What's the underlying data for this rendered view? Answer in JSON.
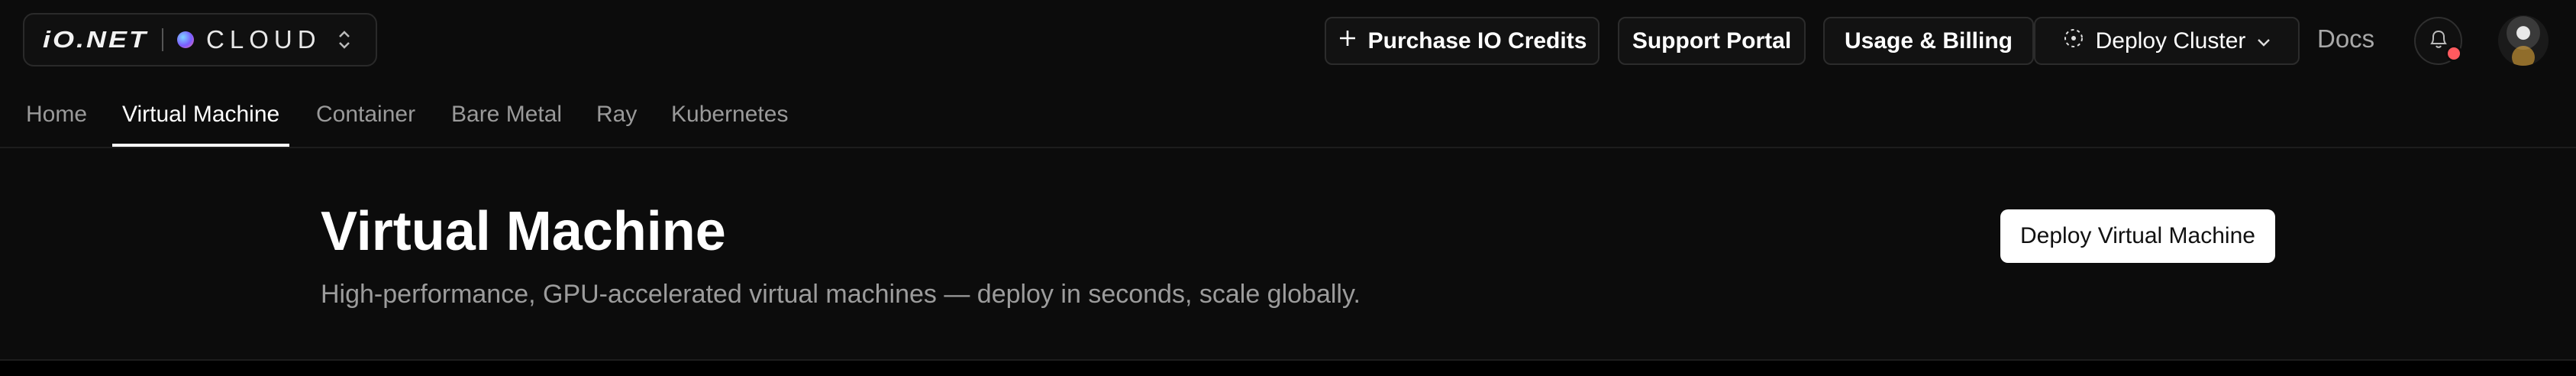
{
  "brand": {
    "logo_text": "iO.NET",
    "product": "CLOUD"
  },
  "topbar": {
    "purchase_label": "Purchase IO Credits",
    "support_label": "Support Portal",
    "usage_label": "Usage & Billing",
    "deploy_cluster_label": "Deploy Cluster",
    "docs_label": "Docs"
  },
  "tabs": [
    {
      "label": "Home",
      "active": false
    },
    {
      "label": "Virtual Machine",
      "active": true
    },
    {
      "label": "Container",
      "active": false
    },
    {
      "label": "Bare Metal",
      "active": false
    },
    {
      "label": "Ray",
      "active": false
    },
    {
      "label": "Kubernetes",
      "active": false
    }
  ],
  "page": {
    "title": "Virtual Machine",
    "subtitle": "High-performance, GPU-accelerated virtual machines — deploy in seconds, scale globally.",
    "primary_action": "Deploy Virtual Machine"
  },
  "colors": {
    "background": "#0c0c0c",
    "notification_badge": "#ff5a5f",
    "primary_button": "#ffffff"
  },
  "icons": [
    "plus-icon",
    "cluster-icon",
    "chevron-down-icon",
    "bell-icon",
    "selector-icon"
  ]
}
